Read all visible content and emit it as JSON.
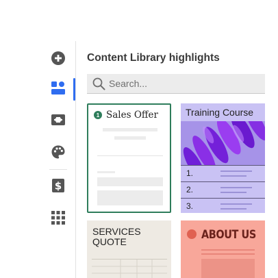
{
  "panel": {
    "title": "Content Library highlights",
    "search": {
      "placeholder": "Search..."
    }
  },
  "rail": {
    "items": [
      {
        "name": "add",
        "icon": "plus-circle-icon"
      },
      {
        "name": "templates",
        "icon": "template-layout-icon",
        "active": true
      },
      {
        "name": "media",
        "icon": "film-frame-icon"
      },
      {
        "name": "design",
        "icon": "palette-icon"
      },
      {
        "name": "pricing",
        "icon": "dollar-icon"
      },
      {
        "name": "apps",
        "icon": "grid-icon"
      }
    ],
    "accent_color": "#2f6df0",
    "icon_color": "#555555"
  },
  "cards": [
    {
      "title": "Sales Offer",
      "badge": "1",
      "border_color": "#2e7d5b"
    },
    {
      "title": "Training Course",
      "items": [
        "1.",
        "2.",
        "3."
      ],
      "background": "#c9c2f4"
    },
    {
      "title_lines": [
        "SERVICES",
        "QUOTE"
      ],
      "background": "#eeeae3"
    },
    {
      "title": "ABOUT US",
      "background": "#f8a79a"
    }
  ]
}
